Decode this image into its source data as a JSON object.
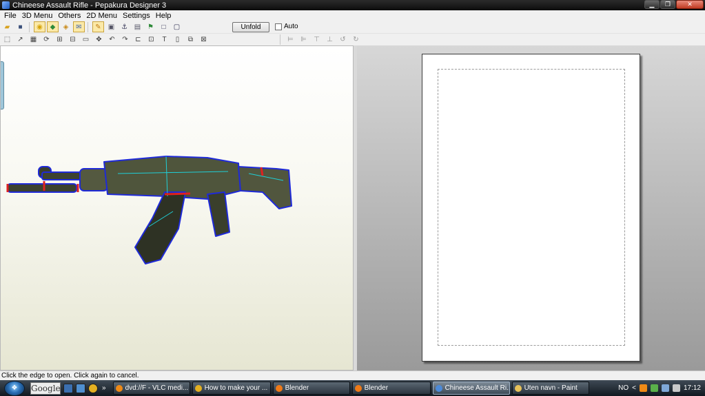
{
  "window": {
    "title": "Chineese Assault Rifle - Pepakura Designer 3",
    "controls": [
      "minimize",
      "maximize",
      "close"
    ]
  },
  "menu": [
    "File",
    "3D Menu",
    "Others",
    "2D Menu",
    "Settings",
    "Help"
  ],
  "toolbar": {
    "unfold_label": "Unfold",
    "auto_label": "Auto",
    "auto_checked": false
  },
  "viewer3d": {
    "model_colors": {
      "wireframe": "#1f2ad8",
      "fold_edge": "#1fd0d8",
      "cut_edge": "#e02020"
    }
  },
  "status": {
    "text": "Click the edge to open. Click again to cancel."
  },
  "taskbar": {
    "search_label": "Google",
    "overflow": "»",
    "items": [
      {
        "label": "dvd://F - VLC medi...",
        "icon": "vlc-icon",
        "color": "#f08a16"
      },
      {
        "label": "How to make your ...",
        "icon": "chrome-icon",
        "color": "#e4b021"
      },
      {
        "label": "Blender",
        "icon": "blender-icon",
        "color": "#f07a17"
      },
      {
        "label": "Blender",
        "icon": "blender-icon",
        "color": "#f07a17"
      },
      {
        "label": "Chineese Assault Ri...",
        "icon": "pepakura-icon",
        "color": "#4c8ad8"
      },
      {
        "label": "Uten navn - Paint",
        "icon": "paint-icon",
        "color": "#e8c25a"
      }
    ],
    "language": "NO",
    "tray_arrow": "<",
    "clock": "17:12"
  }
}
